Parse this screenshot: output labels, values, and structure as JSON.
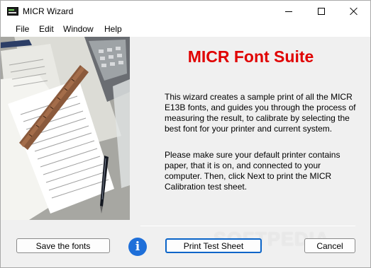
{
  "window": {
    "title": "MICR Wizard",
    "icon": "app-terminal-icon",
    "controls": {
      "minimize": "minimize-icon",
      "maximize": "maximize-icon",
      "close": "close-icon"
    }
  },
  "menu": [
    "File",
    "Edit",
    "Window",
    "Help"
  ],
  "content": {
    "heading": "MICR Font Suite",
    "paragraph1": "This wizard creates a sample print of all the MICR E13B fonts, and guides you through the process of measuring the result, to calibrate by selecting the best font for your printer and current system.",
    "paragraph2": "Please make sure your default printer contains paper, that it is on, and connected to your computer. Then, click Next to print the MICR Calibration test sheet."
  },
  "buttons": {
    "save": "Save the fonts",
    "print": "Print Test Sheet",
    "cancel": "Cancel"
  },
  "info_icon": "i",
  "watermark": "SOFTPEDIA",
  "colors": {
    "heading": "#e00000",
    "info": "#1e6fd9",
    "focus": "#0a64c8",
    "background": "#f0f0f0"
  }
}
